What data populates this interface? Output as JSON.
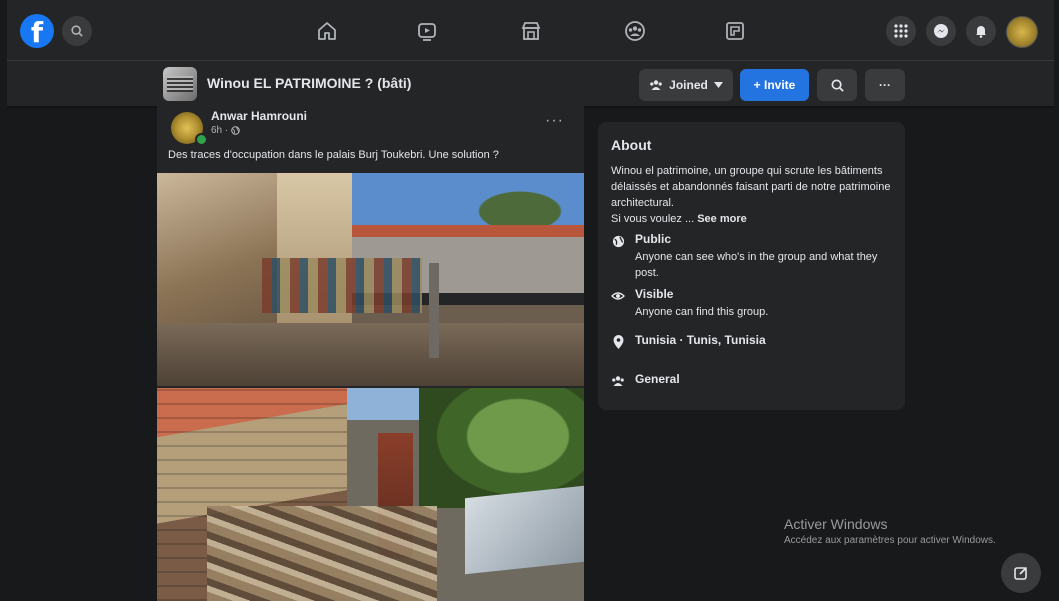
{
  "header": {
    "logo_letter": "f",
    "nav_icons": [
      "home-icon",
      "watch-icon",
      "marketplace-icon",
      "groups-icon",
      "gaming-icon"
    ],
    "right_icons": [
      "menu-grid-icon",
      "messenger-icon",
      "notifications-icon",
      "profile-avatar"
    ]
  },
  "group_bar": {
    "title": "Winou EL PATRIMOINE ? (bâti)",
    "joined_label": "Joined",
    "invite_label": "+ Invite",
    "more_label": "···"
  },
  "post": {
    "author": "Anwar Hamrouni",
    "time": "6h ·",
    "more": "···",
    "text": "Des traces d'occupation dans le palais Burj Toukebri.  Une solution ?"
  },
  "about": {
    "title": "About",
    "description": "Winou el patrimoine, un groupe qui scrute les bâtiments délaissés et abandonnés faisant parti de notre patrimoine architectural.",
    "description_more": "Si vous voulez ... ",
    "see_more": "See more",
    "public_title": "Public",
    "public_desc": "Anyone can see who's in the group and what they post.",
    "visible_title": "Visible",
    "visible_desc": "Anyone can find this group.",
    "location": "Tunisia · Tunis, Tunisia",
    "category": "General"
  },
  "watermark": {
    "title": "Activer Windows",
    "subtitle": "Accédez aux paramètres pour activer Windows."
  },
  "colors": {
    "background": "#18191a",
    "surface": "#242526",
    "primary": "#2374e1",
    "text": "#e4e6eb",
    "secondary_text": "#b0b3b8"
  }
}
